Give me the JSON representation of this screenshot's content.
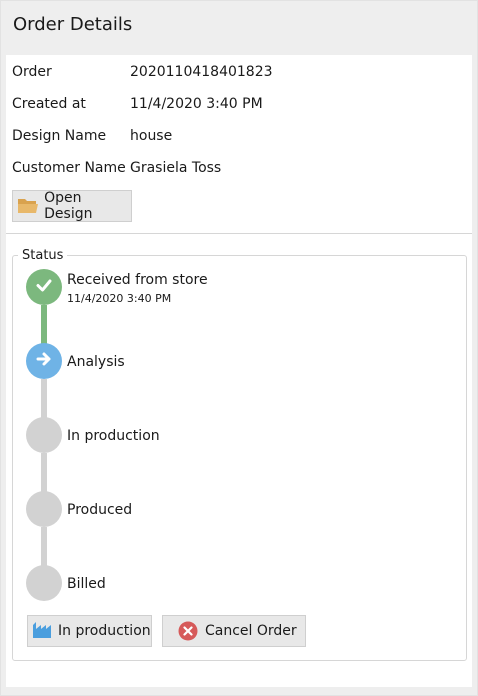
{
  "window": {
    "title": "Order Details"
  },
  "details": {
    "order_label": "Order",
    "order_value": "2020110418401823",
    "created_label": "Created at",
    "created_value": "11/4/2020 3:40 PM",
    "design_label": "Design Name",
    "design_value": "house",
    "customer_label": "Customer Name",
    "customer_value": "Grasiela Toss"
  },
  "open_design_button": {
    "label": "Open Design",
    "icon": "folder-open-icon"
  },
  "status": {
    "title": "Status",
    "steps": [
      {
        "label": "Received from store",
        "sublabel": "11/4/2020 3:40 PM",
        "state": "done",
        "icon": "check-icon"
      },
      {
        "label": "Analysis",
        "state": "current",
        "icon": "arrow-right-icon"
      },
      {
        "label": "In production",
        "state": "pending"
      },
      {
        "label": "Produced",
        "state": "pending"
      },
      {
        "label": "Billed",
        "state": "pending"
      }
    ]
  },
  "actions": {
    "advance_label": "In production",
    "advance_icon": "factory-icon",
    "cancel_label": "Cancel Order",
    "cancel_icon": "cancel-icon"
  },
  "colors": {
    "done": "#7cb87e",
    "current": "#6fb3e6",
    "pending": "#d2d2d2",
    "cancel": "#d65a5a",
    "factory": "#4a9ede",
    "folder": "#e8b86a"
  }
}
